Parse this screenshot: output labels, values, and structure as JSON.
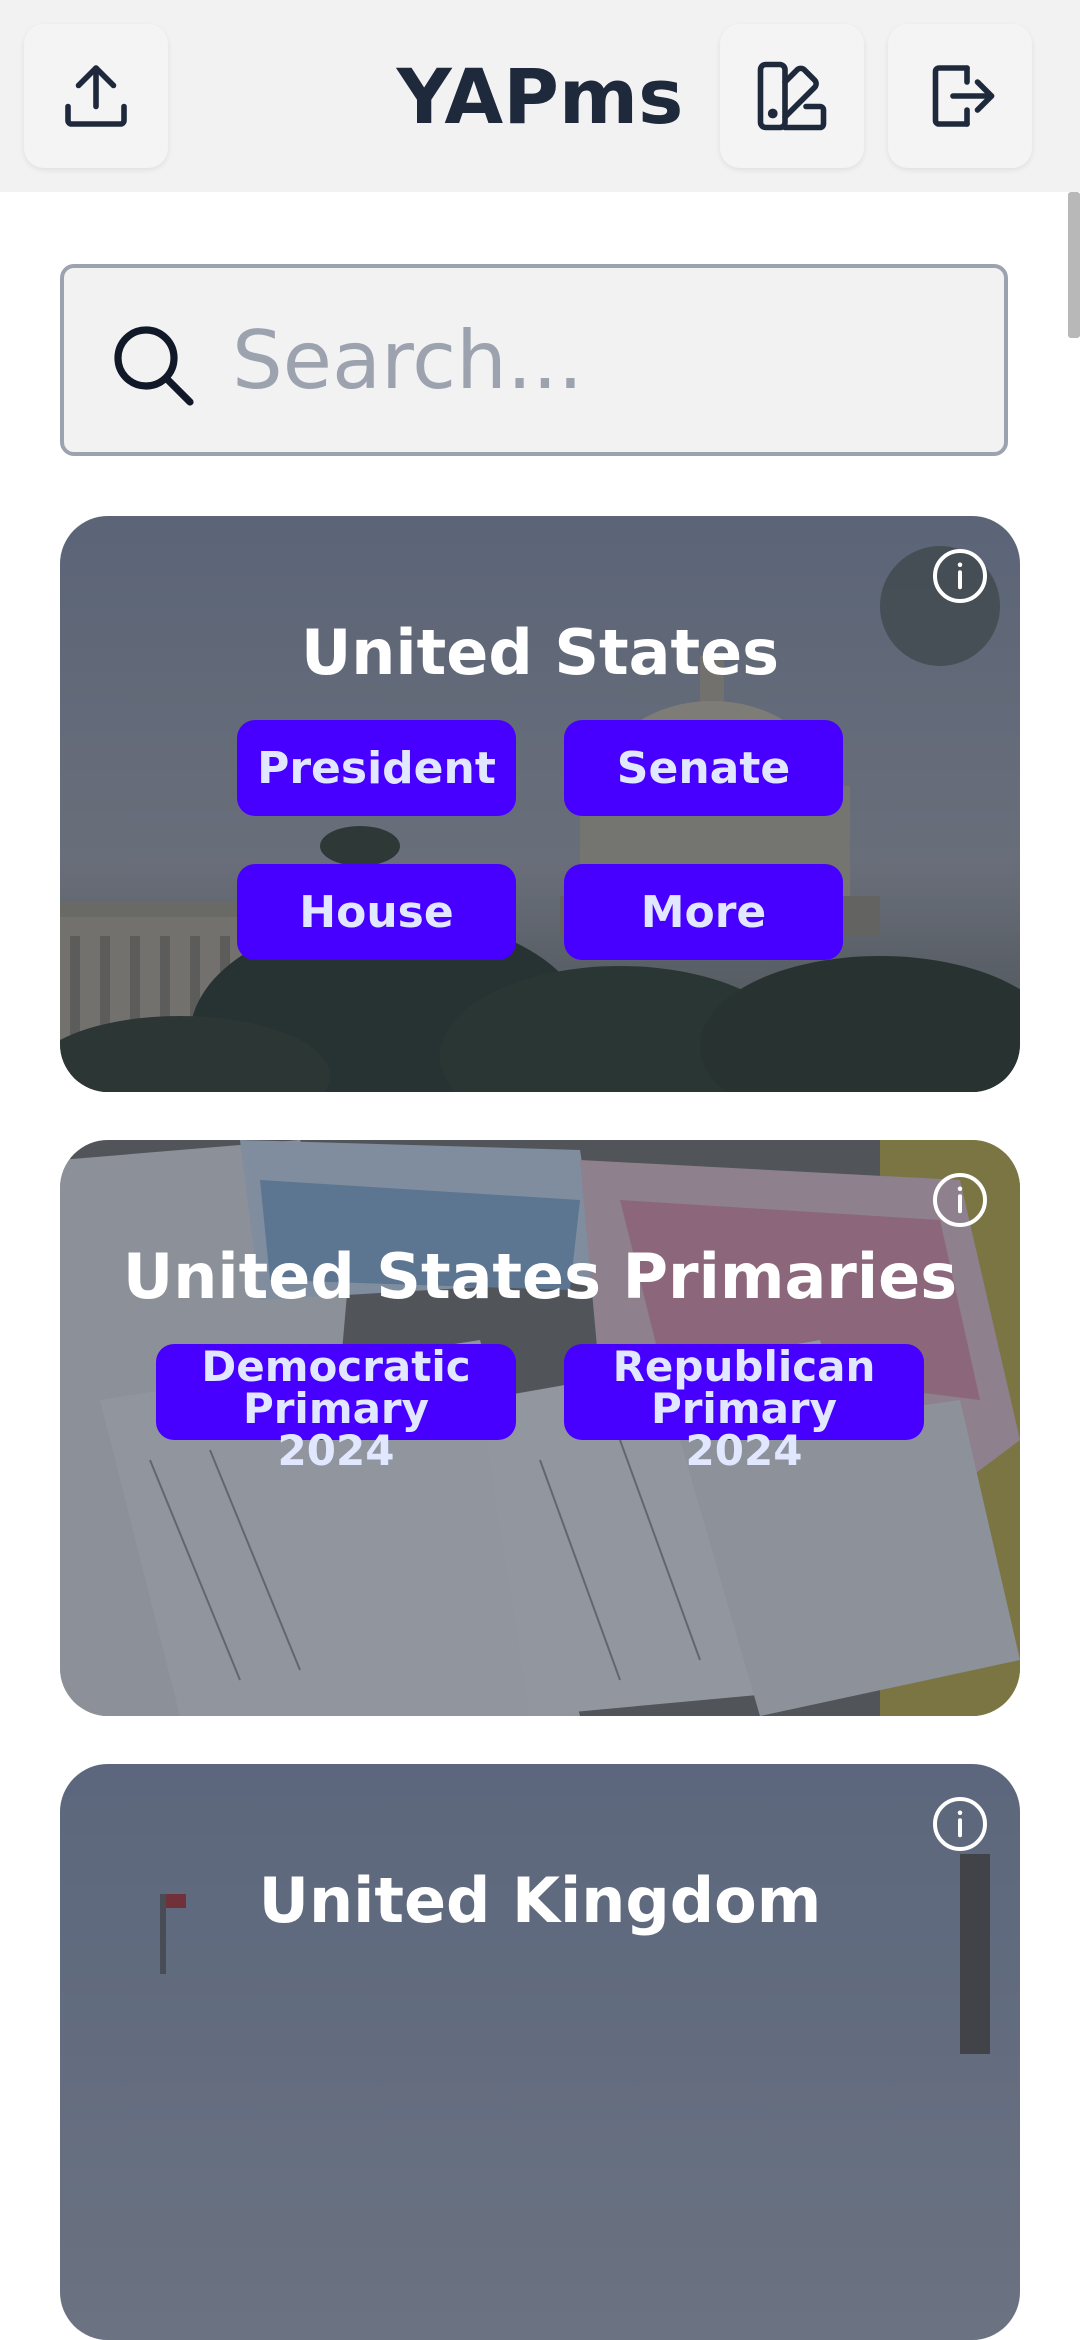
{
  "header": {
    "title": "YAPms",
    "upload_icon": "upload-icon",
    "theme_icon": "palette-icon",
    "logout_icon": "logout-icon"
  },
  "search": {
    "placeholder": "Search..."
  },
  "cards": [
    {
      "title": "United States",
      "buttons": [
        "President",
        "Senate",
        "House",
        "More"
      ]
    },
    {
      "title": "United States Primaries",
      "buttons": [
        {
          "line1": "Democratic",
          "line2": "Primary",
          "line3": "2024"
        },
        {
          "line1": "Republican",
          "line2": "Primary",
          "line3": "2024"
        }
      ]
    },
    {
      "title": "United Kingdom",
      "buttons": []
    }
  ],
  "colors": {
    "accent": "#4700ff",
    "button_text": "#e0e7ff",
    "title": "#1e293b"
  }
}
